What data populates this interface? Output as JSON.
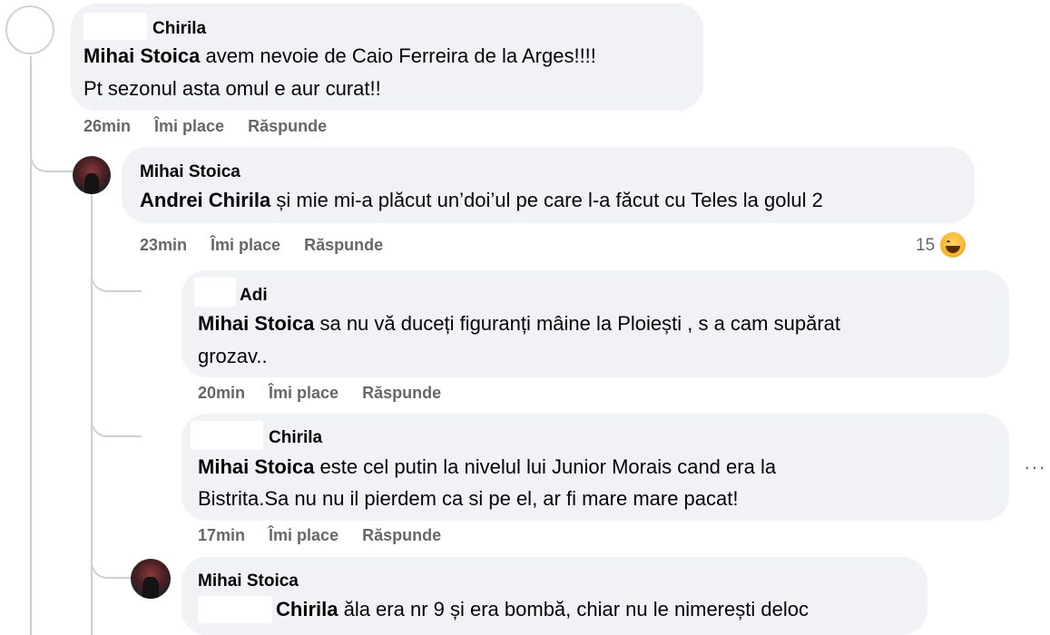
{
  "comments": [
    {
      "author": "Chirila",
      "lines": [
        {
          "mention": "Mihai Stoica",
          "text": " avem nevoie de Caio Ferreira de la Arges!!!!"
        },
        {
          "mention": "",
          "text": "Pt sezonul asta omul e aur curat!!"
        }
      ],
      "time": "26min",
      "like_label": "Îmi place",
      "reply_label": "Răspunde"
    },
    {
      "author": "Mihai Stoica",
      "lines": [
        {
          "mention": "Andrei Chirila",
          "text": " și mie mi-a plăcut un’doi’ul pe care l-a făcut cu Teles la golul 2"
        }
      ],
      "time": "23min",
      "like_label": "Îmi place",
      "reply_label": "Răspunde",
      "reaction_count": "15",
      "reaction_icon": "laugh-emoji-icon"
    },
    {
      "author": "Adi",
      "lines": [
        {
          "mention": "Mihai Stoica",
          "text": " sa nu vă duceți figuranți mâine la Ploiești , s a cam supărat"
        },
        {
          "mention": "",
          "text": "grozav.."
        }
      ],
      "time": "20min",
      "like_label": "Îmi place",
      "reply_label": "Răspunde"
    },
    {
      "author": "Chirila",
      "lines": [
        {
          "mention": "Mihai Stoica",
          "text": " este cel putin la nivelul lui Junior Morais cand era la"
        },
        {
          "mention": "",
          "text": "Bistrita.Sa nu nu il pierdem ca si pe el, ar fi mare mare pacat!"
        }
      ],
      "time": "17min",
      "like_label": "Îmi place",
      "reply_label": "Răspunde",
      "more_icon": "more-options-icon",
      "more_text": "···"
    },
    {
      "author": "Mihai Stoica",
      "lines": [
        {
          "mention": "Chirila",
          "text": " ăla era nr 9 și era bombă, chiar nu le nimerești deloc"
        }
      ]
    }
  ],
  "colors": {
    "bubble": "#f0f2f5",
    "meta_text": "#65676b",
    "thread_line": "#ced0d4"
  }
}
